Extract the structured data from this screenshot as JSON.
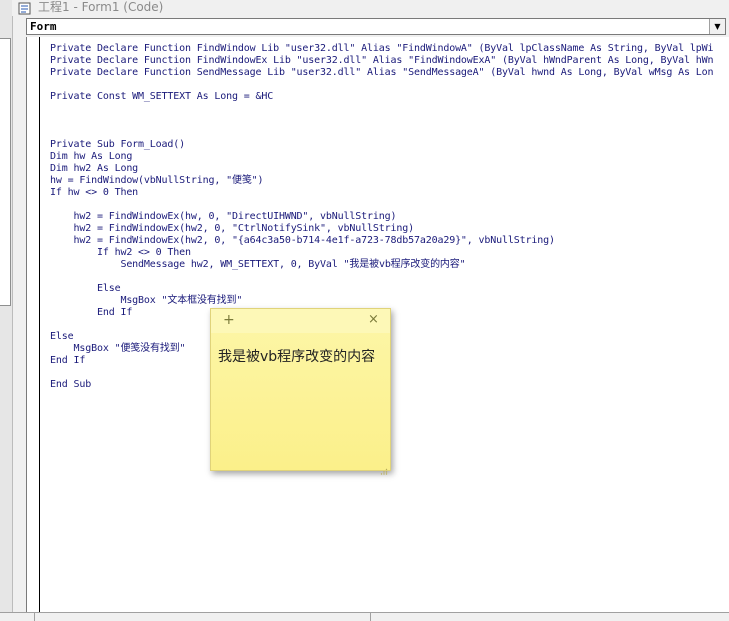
{
  "window": {
    "title": "工程1 - Form1 (Code)"
  },
  "object_selector": {
    "value": "Form",
    "arrow": "▼"
  },
  "code_lines": [
    "Private Declare Function FindWindow Lib \"user32.dll\" Alias \"FindWindowA\" (ByVal lpClassName As String, ByVal lpWi",
    "Private Declare Function FindWindowEx Lib \"user32.dll\" Alias \"FindWindowExA\" (ByVal hWndParent As Long, ByVal hWn",
    "Private Declare Function SendMessage Lib \"user32.dll\" Alias \"SendMessageA\" (ByVal hwnd As Long, ByVal wMsg As Lon",
    "",
    "Private Const WM_SETTEXT As Long = &HC",
    "",
    "",
    "",
    "Private Sub Form_Load()",
    "Dim hw As Long",
    "Dim hw2 As Long",
    "hw = FindWindow(vbNullString, \"便笺\")",
    "If hw <> 0 Then",
    "",
    "    hw2 = FindWindowEx(hw, 0, \"DirectUIHWND\", vbNullString)",
    "    hw2 = FindWindowEx(hw2, 0, \"CtrlNotifySink\", vbNullString)",
    "    hw2 = FindWindowEx(hw2, 0, \"{a64c3a50-b714-4e1f-a723-78db57a20a29}\", vbNullString)",
    "        If hw2 <> 0 Then",
    "            SendMessage hw2, WM_SETTEXT, 0, ByVal \"我是被vb程序改变的内容\"",
    "",
    "        Else",
    "            MsgBox \"文本框没有找到\"",
    "        End If",
    "",
    "Else",
    "    MsgBox \"便笺没有找到\"",
    "End If",
    "",
    "End Sub"
  ],
  "sticky_note": {
    "add_symbol": "+",
    "close_symbol": "×",
    "text": "我是被vb程序改变的内容"
  },
  "colors": {
    "code_text": "#1a1a7a",
    "note_background": "#fbf08a"
  }
}
